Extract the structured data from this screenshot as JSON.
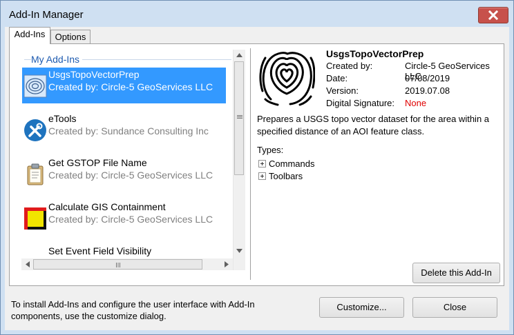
{
  "window": {
    "title": "Add-In Manager"
  },
  "tabs": [
    {
      "label": "Add-Ins"
    },
    {
      "label": "Options"
    }
  ],
  "list": {
    "group_title": "My Add-Ins",
    "items": [
      {
        "name": "UsgsTopoVectorPrep",
        "creator": "Created by: Circle-5 GeoServices LLC"
      },
      {
        "name": "eTools",
        "creator": "Created by: Sundance Consulting Inc"
      },
      {
        "name": "Get GSTOP File Name",
        "creator": "Created by: Circle-5 GeoServices LLC"
      },
      {
        "name": "Calculate GIS Containment",
        "creator": "Created by: Circle-5 GeoServices LLC"
      },
      {
        "name": "Set Event Field Visibility"
      }
    ],
    "selected_index": 0
  },
  "details": {
    "name": "UsgsTopoVectorPrep",
    "created_by_label": "Created by:",
    "created_by": "Circle-5 GeoServices LLC",
    "date_label": "Date:",
    "date": "07/08/2019",
    "version_label": "Version:",
    "version": "2019.07.08",
    "signature_label": "Digital Signature:",
    "signature": "None",
    "description": "Prepares a USGS topo vector dataset for the area within a specified distance of an AOI feature class.",
    "types_label": "Types:",
    "types": [
      "Commands",
      "Toolbars"
    ],
    "delete_label": "Delete this Add-In"
  },
  "footer": {
    "text": "To install Add-Ins and configure the user interface with Add-In components, use the customize dialog.",
    "customize_label": "Customize...",
    "close_label": "Close"
  },
  "colors": {
    "selection": "#3399ff",
    "group_title": "#1e5bb0",
    "signature_none": "#e00000",
    "close_button": "#c7514b"
  },
  "icons": {
    "close": "close-icon",
    "topo": "topo-map-icon",
    "etools": "tools-icon",
    "gstop": "clipboard-icon",
    "containment": "containment-icon"
  }
}
